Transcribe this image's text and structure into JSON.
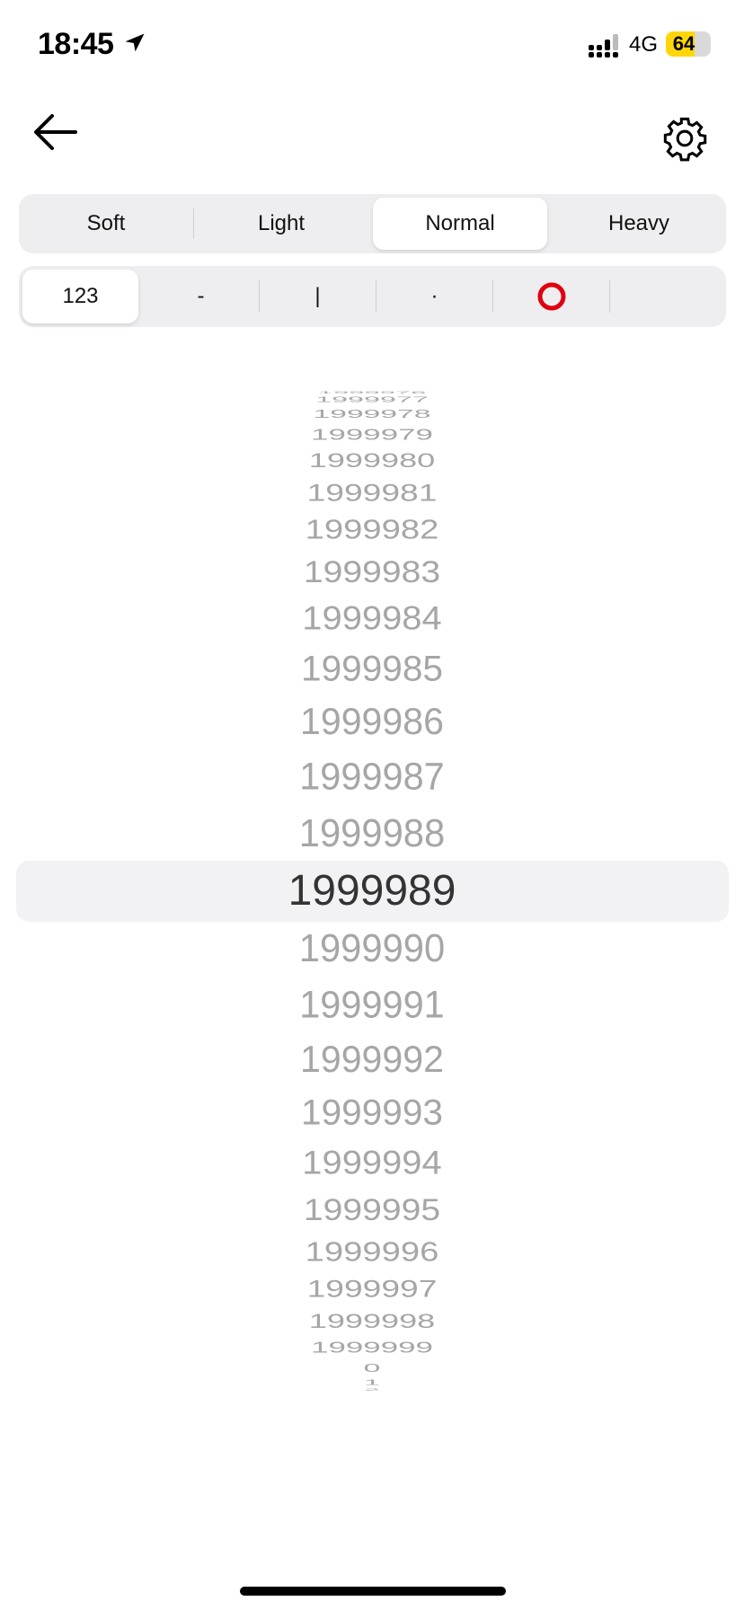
{
  "status_bar": {
    "time": "18:45",
    "network": "4G",
    "battery": "64",
    "battery_level": 0.64,
    "battery_color": "#FFD60A"
  },
  "header": {
    "back_icon": "arrow-left-icon",
    "settings_icon": "gear-icon"
  },
  "intensity": {
    "options": [
      "Soft",
      "Light",
      "Normal",
      "Heavy"
    ],
    "selected": "Normal"
  },
  "style": {
    "options": [
      "123",
      "-",
      "|",
      "·",
      "red-circle-icon",
      ""
    ],
    "selected": "123",
    "accent": "#E0000F"
  },
  "picker": {
    "values": [
      "1999976",
      "1999977",
      "1999978",
      "1999979",
      "1999980",
      "1999981",
      "1999982",
      "1999983",
      "1999984",
      "1999985",
      "1999986",
      "1999987",
      "1999988",
      "1999989",
      "1999990",
      "1999991",
      "1999992",
      "1999993",
      "1999994",
      "1999995",
      "1999996",
      "1999997",
      "1999998",
      "1999999",
      "0",
      "1",
      "2"
    ],
    "selected": "1999989"
  }
}
